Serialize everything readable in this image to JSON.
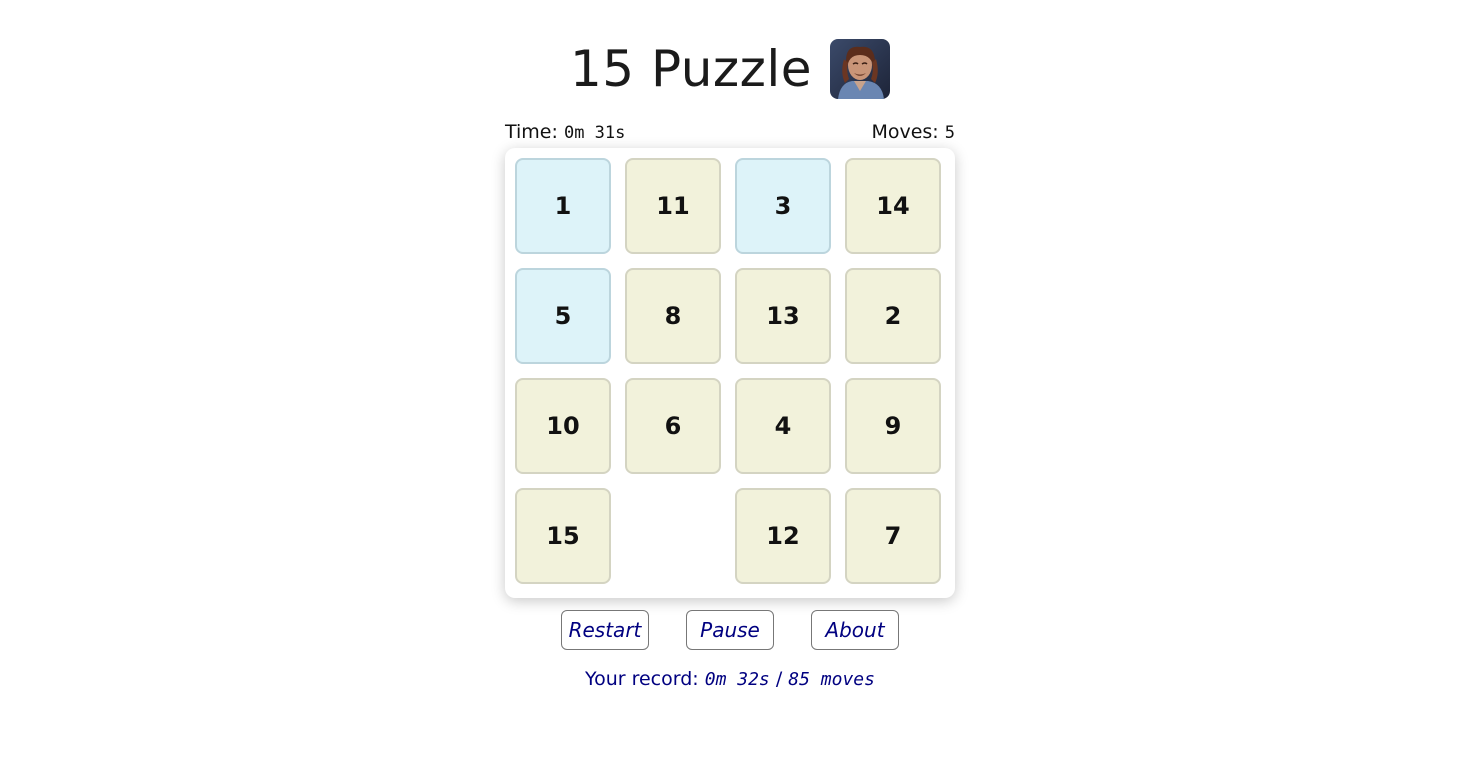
{
  "header": {
    "title": "15 Puzzle",
    "avatar_icon": "portrait-avatar-icon"
  },
  "stats": {
    "time_label": "Time:",
    "time_value": "0m 31s",
    "moves_label": "Moves:",
    "moves_value": "5"
  },
  "board": {
    "rows": [
      [
        1,
        11,
        3,
        14
      ],
      [
        5,
        8,
        13,
        2
      ],
      [
        10,
        6,
        4,
        9
      ],
      [
        15,
        null,
        12,
        7
      ]
    ],
    "colors": {
      "tile_wrong": "#f2f2db",
      "tile_correct": "#ddf3f9"
    }
  },
  "controls": {
    "restart_label": "Restart",
    "pause_label": "Pause",
    "about_label": "About"
  },
  "record": {
    "label": "Your record:",
    "time": "0m 32s",
    "separator": "/",
    "moves": "85 moves"
  }
}
